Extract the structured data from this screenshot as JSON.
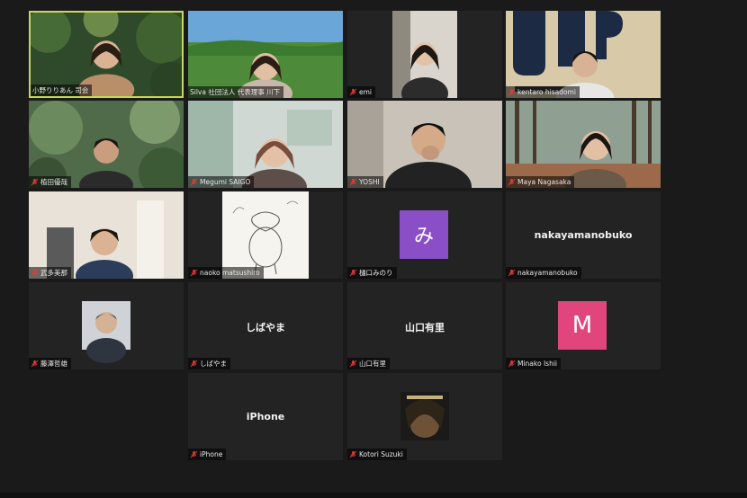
{
  "participants": [
    {
      "id": "p1",
      "name": "小野りりあん 司会",
      "muted": false,
      "type": "video"
    },
    {
      "id": "p2",
      "name": "Silva 社団法人 代表理事 川下",
      "muted": false,
      "type": "video"
    },
    {
      "id": "p3",
      "name": "emi",
      "muted": true,
      "type": "video"
    },
    {
      "id": "p4",
      "name": "kentaro hisadomi",
      "muted": true,
      "type": "video"
    },
    {
      "id": "p5",
      "name": "植田優哉",
      "muted": true,
      "type": "video"
    },
    {
      "id": "p6",
      "name": "Megumi SAIGO",
      "muted": true,
      "type": "video"
    },
    {
      "id": "p7",
      "name": "YOSHI",
      "muted": true,
      "type": "video"
    },
    {
      "id": "p8",
      "name": "Maya Nagasaka",
      "muted": true,
      "type": "video"
    },
    {
      "id": "p9",
      "name": "武多美那",
      "muted": true,
      "type": "video"
    },
    {
      "id": "p10",
      "name": "naoko matsushiro",
      "muted": true,
      "type": "picture"
    },
    {
      "id": "p11",
      "name": "樋口みのり",
      "muted": true,
      "type": "avatar",
      "letter": "み",
      "color": "#8a4fc7"
    },
    {
      "id": "p12",
      "name": "nakayamanobuko",
      "muted": true,
      "type": "name",
      "display": "nakayamanobuko"
    },
    {
      "id": "p13",
      "name": "藤澤哲雄",
      "muted": true,
      "type": "picture"
    },
    {
      "id": "p14",
      "name": "しばやま",
      "muted": true,
      "type": "name",
      "display": "しばやま"
    },
    {
      "id": "p15",
      "name": "山口有里",
      "muted": true,
      "type": "name",
      "display": "山口有里"
    },
    {
      "id": "p16",
      "name": "Minako Ishii",
      "muted": true,
      "type": "avatar",
      "letter": "M",
      "color": "#e0457b"
    },
    {
      "id": "p17",
      "name": "iPhone",
      "muted": true,
      "type": "name",
      "display": "iPhone"
    },
    {
      "id": "p18",
      "name": "Kotori Suzuki",
      "muted": true,
      "type": "picture"
    }
  ],
  "colors": {
    "active_speaker_border": "#c7d85a",
    "mute_icon": "#e03b3b"
  }
}
